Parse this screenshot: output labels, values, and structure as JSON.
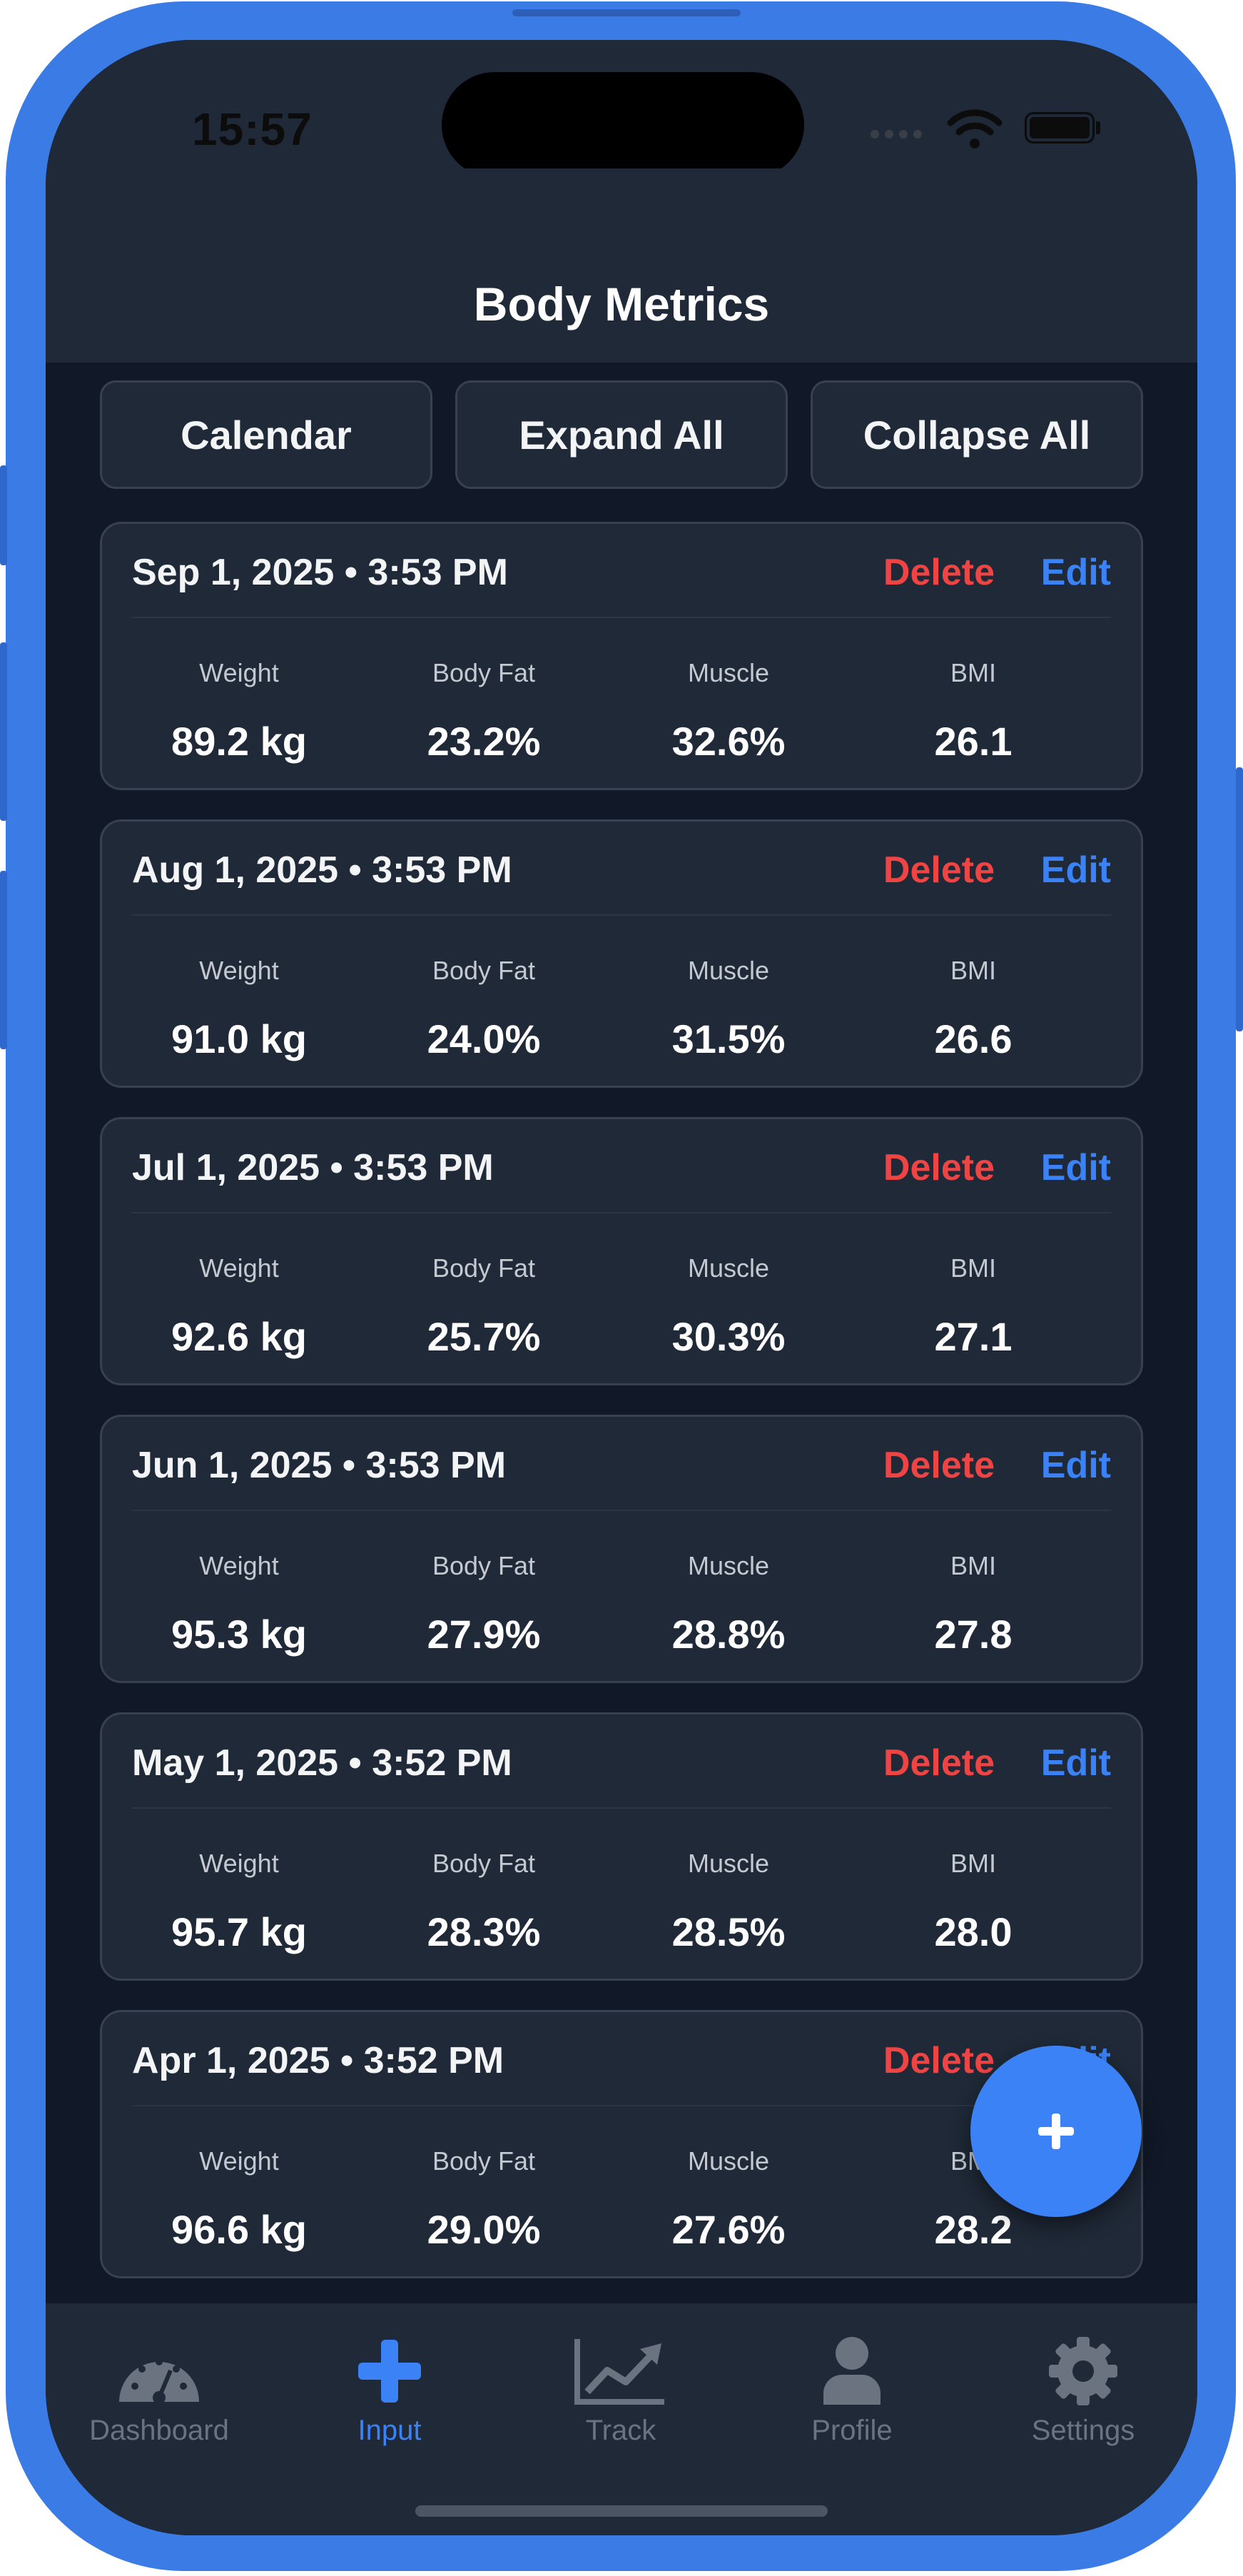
{
  "status_bar": {
    "time": "15:57"
  },
  "header": {
    "title": "Body Metrics"
  },
  "actions": {
    "calendar": "Calendar",
    "expand_all": "Expand All",
    "collapse_all": "Collapse All"
  },
  "entry_actions": {
    "delete": "Delete",
    "edit": "Edit"
  },
  "metric_labels": {
    "weight": "Weight",
    "body_fat": "Body Fat",
    "muscle": "Muscle",
    "bmi": "BMI"
  },
  "entries": [
    {
      "date": "Sep 1, 2025 • 3:53 PM",
      "weight": "89.2 kg",
      "body_fat": "23.2%",
      "muscle": "32.6%",
      "bmi": "26.1"
    },
    {
      "date": "Aug 1, 2025 • 3:53 PM",
      "weight": "91.0 kg",
      "body_fat": "24.0%",
      "muscle": "31.5%",
      "bmi": "26.6"
    },
    {
      "date": "Jul 1, 2025 • 3:53 PM",
      "weight": "92.6 kg",
      "body_fat": "25.7%",
      "muscle": "30.3%",
      "bmi": "27.1"
    },
    {
      "date": "Jun 1, 2025 • 3:53 PM",
      "weight": "95.3 kg",
      "body_fat": "27.9%",
      "muscle": "28.8%",
      "bmi": "27.8"
    },
    {
      "date": "May 1, 2025 • 3:52 PM",
      "weight": "95.7 kg",
      "body_fat": "28.3%",
      "muscle": "28.5%",
      "bmi": "28.0"
    },
    {
      "date": "Apr 1, 2025 • 3:52 PM",
      "weight": "96.6 kg",
      "body_fat": "29.0%",
      "muscle": "27.6%",
      "bmi": "28.2"
    }
  ],
  "fab": {
    "icon": "plus-icon"
  },
  "tabs": [
    {
      "label": "Dashboard",
      "icon": "dashboard-gauge-icon",
      "active": false
    },
    {
      "label": "Input",
      "icon": "plus-icon",
      "active": true
    },
    {
      "label": "Track",
      "icon": "chart-line-icon",
      "active": false
    },
    {
      "label": "Profile",
      "icon": "user-icon",
      "active": false
    },
    {
      "label": "Settings",
      "icon": "gear-icon",
      "active": false
    }
  ],
  "colors": {
    "accent": "#3b82f6",
    "danger": "#ef4444",
    "background": "#111827",
    "surface": "#1f2937",
    "device_frame": "#3a7be6"
  }
}
